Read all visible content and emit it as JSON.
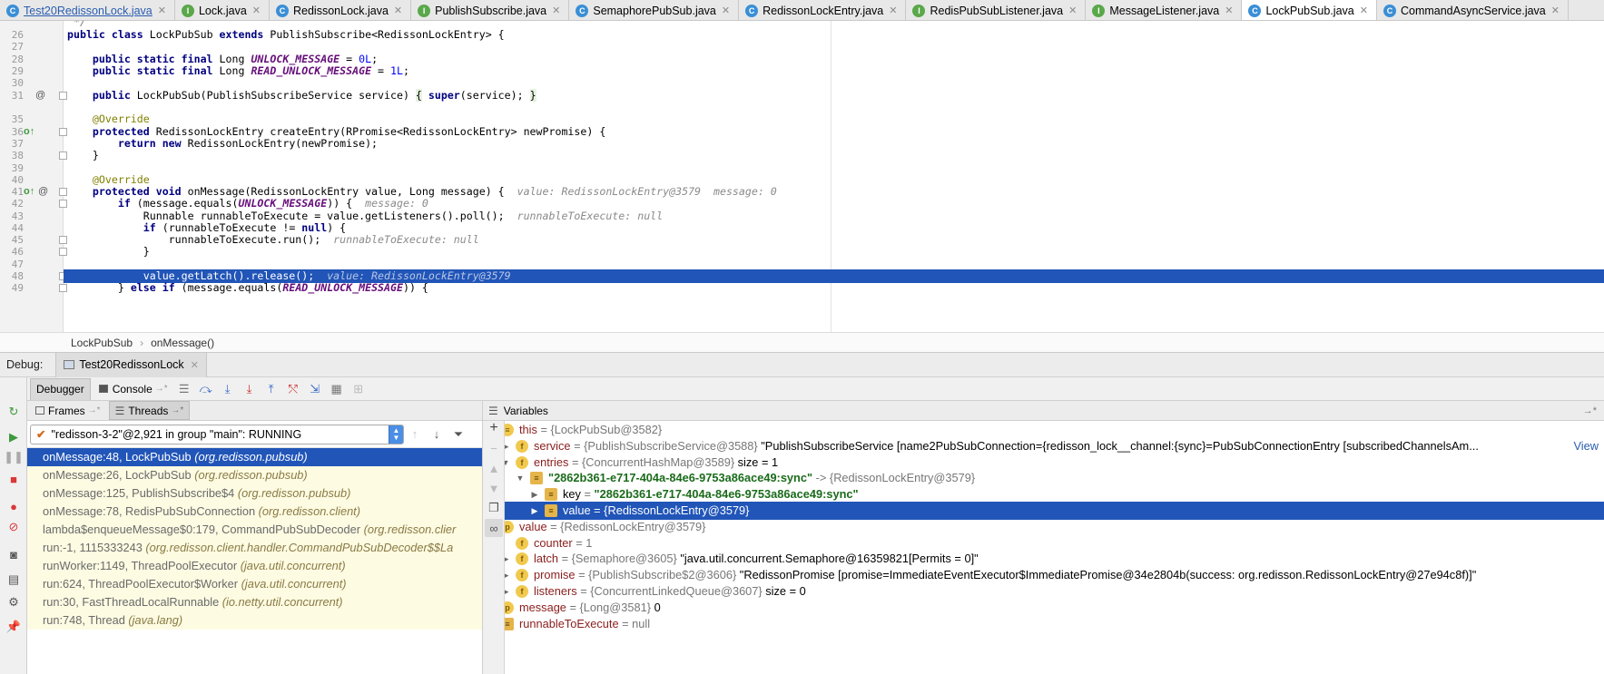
{
  "tabs": [
    {
      "label": "Test20RedissonLock.java",
      "kind": "c"
    },
    {
      "label": "Lock.java",
      "kind": "i"
    },
    {
      "label": "RedissonLock.java",
      "kind": "c"
    },
    {
      "label": "PublishSubscribe.java",
      "kind": "i"
    },
    {
      "label": "SemaphorePubSub.java",
      "kind": "c"
    },
    {
      "label": "RedissonLockEntry.java",
      "kind": "c"
    },
    {
      "label": "RedisPubSubListener.java",
      "kind": "i"
    },
    {
      "label": "MessageListener.java",
      "kind": "i"
    },
    {
      "label": "LockPubSub.java",
      "kind": "c"
    },
    {
      "label": "CommandAsyncService.java",
      "kind": "c"
    }
  ],
  "editor": {
    "line_numbers": [
      "26",
      "27",
      "28",
      "29",
      "30",
      "31",
      "35",
      "36",
      "37",
      "38",
      "39",
      "40",
      "41",
      "42",
      "43",
      "44",
      "45",
      "46",
      "47",
      "48",
      "49"
    ],
    "hints": {
      "l41": "value: RedissonLockEntry@3579  message: 0",
      "l42": "message: 0",
      "l43": "runnableToExecute: null",
      "l45": "runnableToExecute: null",
      "l48": "value: RedissonLockEntry@3579"
    }
  },
  "breadcrumb": {
    "class": "LockPubSub",
    "method": "onMessage()"
  },
  "debug": {
    "label": "Debug:",
    "session": "Test20RedissonLock",
    "tab_debugger": "Debugger",
    "tab_console": "Console"
  },
  "frames_panel": {
    "tab_frames": "Frames",
    "tab_threads": "Threads",
    "thread": "\"redisson-3-2\"@2,921 in group \"main\": RUNNING",
    "frames": [
      {
        "method": "onMessage:48, LockPubSub",
        "pkg": "(org.redisson.pubsub)"
      },
      {
        "method": "onMessage:26, LockPubSub",
        "pkg": "(org.redisson.pubsub)"
      },
      {
        "method": "onMessage:125, PublishSubscribe$4",
        "pkg": "(org.redisson.pubsub)"
      },
      {
        "method": "onMessage:78, RedisPubSubConnection",
        "pkg": "(org.redisson.client)"
      },
      {
        "method": "lambda$enqueueMessage$0:179, CommandPubSubDecoder",
        "pkg": "(org.redisson.clier"
      },
      {
        "method": "run:-1, 1115333243",
        "pkg": "(org.redisson.client.handler.CommandPubSubDecoder$$La"
      },
      {
        "method": "runWorker:1149, ThreadPoolExecutor",
        "pkg": "(java.util.concurrent)"
      },
      {
        "method": "run:624, ThreadPoolExecutor$Worker",
        "pkg": "(java.util.concurrent)"
      },
      {
        "method": "run:30, FastThreadLocalRunnable",
        "pkg": "(io.netty.util.concurrent)"
      },
      {
        "method": "run:748, Thread",
        "pkg": "(java.lang)"
      }
    ]
  },
  "variables_panel": {
    "title": "Variables",
    "view_link": "View",
    "rows": [
      {
        "name": "this",
        "type": "= {LockPubSub@3582}",
        "val": ""
      },
      {
        "name": "service",
        "type": "= {PublishSubscribeService@3588}",
        "val": "\"PublishSubscribeService [name2PubSubConnection={redisson_lock__channel:{sync}=PubSubConnectionEntry [subscribedChannelsAm..."
      },
      {
        "name": "entries",
        "type": "= {ConcurrentHashMap@3589}",
        "val": "size = 1"
      },
      {
        "name": "\"2862b361-e717-404a-84e6-9753a86ace49:sync\"",
        "type": "-> {RedissonLockEntry@3579}",
        "val": ""
      },
      {
        "name": "key",
        "type": "=",
        "val": "\"2862b361-e717-404a-84e6-9753a86ace49:sync\""
      },
      {
        "name": "value",
        "type": "= {RedissonLockEntry@3579}",
        "val": ""
      },
      {
        "name": "value",
        "type": "= {RedissonLockEntry@3579}",
        "val": ""
      },
      {
        "name": "counter",
        "type": "= 1",
        "val": ""
      },
      {
        "name": "latch",
        "type": "= {Semaphore@3605}",
        "val": "\"java.util.concurrent.Semaphore@16359821[Permits = 0]\""
      },
      {
        "name": "promise",
        "type": "= {PublishSubscribe$2@3606}",
        "val": "\"RedissonPromise [promise=ImmediateEventExecutor$ImmediatePromise@34e2804b(success: org.redisson.RedissonLockEntry@27e94c8f)]\""
      },
      {
        "name": "listeners",
        "type": "= {ConcurrentLinkedQueue@3607}",
        "val": "size = 0"
      },
      {
        "name": "message",
        "type": "= {Long@3581}",
        "val": "0"
      },
      {
        "name": "runnableToExecute",
        "type": "= null",
        "val": ""
      }
    ]
  }
}
